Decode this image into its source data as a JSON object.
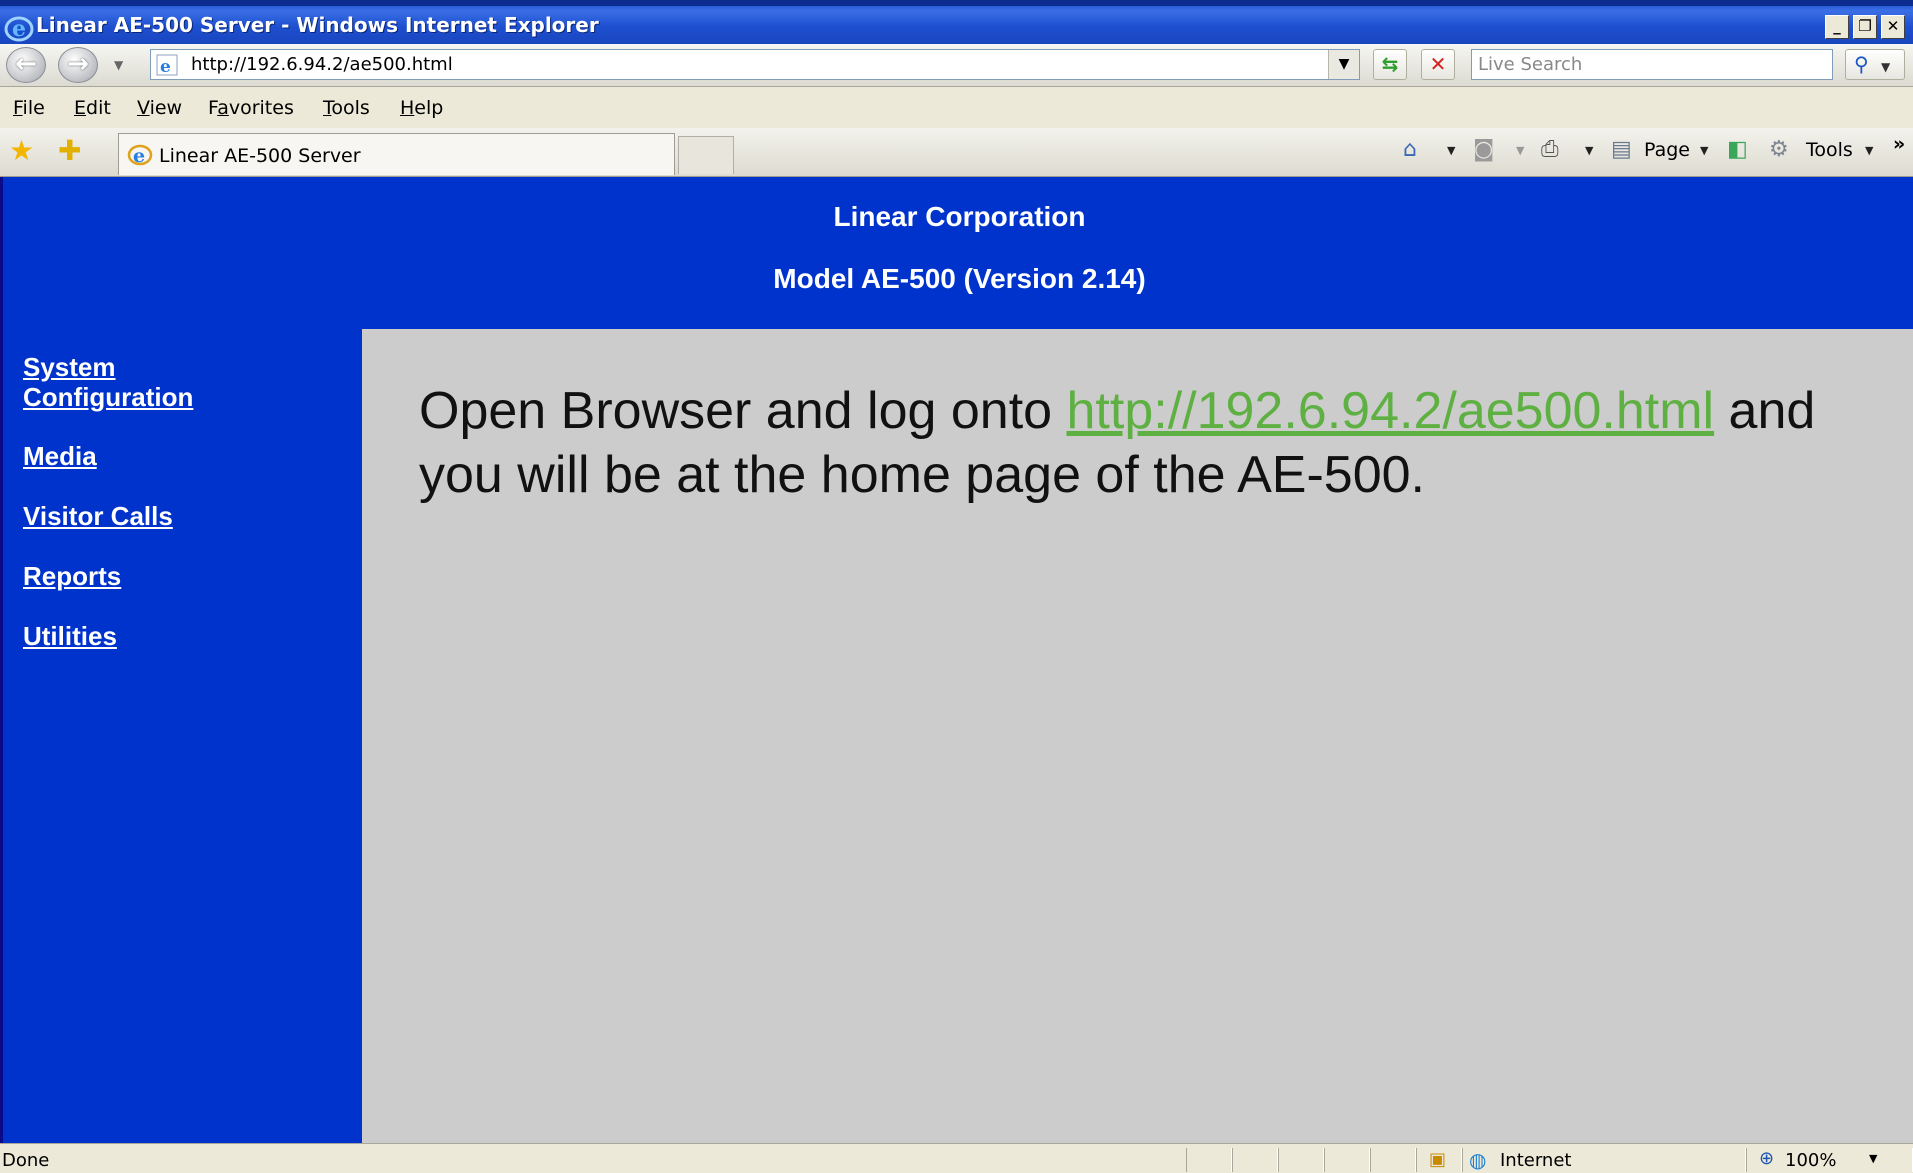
{
  "window": {
    "title": "Linear AE-500 Server - Windows Internet Explorer",
    "minimize": "_",
    "restore": "❐",
    "close": "✕"
  },
  "address_bar": {
    "url": "http://192.6.94.2/ae500.html",
    "search_placeholder": "Live Search"
  },
  "menu": {
    "items": [
      {
        "label": "File",
        "accel": "F",
        "rest": "ile"
      },
      {
        "label": "Edit",
        "accel": "E",
        "rest": "dit"
      },
      {
        "label": "View",
        "accel": "V",
        "rest": "iew"
      },
      {
        "label": "Favorites",
        "pre": "F",
        "accel": "a",
        "rest": "vorites"
      },
      {
        "label": "Tools",
        "accel": "T",
        "rest": "ools"
      },
      {
        "label": "Help",
        "accel": "H",
        "rest": "elp"
      }
    ]
  },
  "tab": {
    "label": "Linear AE-500 Server"
  },
  "command_bar": {
    "page_label": "Page",
    "tools_label": "Tools",
    "icons": [
      "home-icon",
      "feeds-icon",
      "print-icon",
      "page-icon",
      "research-icon",
      "tools-gear-icon"
    ]
  },
  "page": {
    "company": "Linear Corporation",
    "model": "Model AE-500 (Version 2.14)",
    "nav": [
      {
        "line1": "System",
        "line2": "Configuration"
      },
      {
        "line1": "Media"
      },
      {
        "line1": "Visitor Calls"
      },
      {
        "line1": "Reports"
      },
      {
        "line1": "Utilities"
      }
    ],
    "instruction_pre": "Open Browser and log onto ",
    "instruction_link": "http://192.6.94.2/ae500.html",
    "instruction_post": " and you will be at the home page of the AE-500."
  },
  "status": {
    "text": "Done",
    "zone": "Internet",
    "zoom": "100%"
  },
  "colors": {
    "page_blue": "#0033cc",
    "content_gray": "#cccccc",
    "link_green": "#5fb043"
  }
}
